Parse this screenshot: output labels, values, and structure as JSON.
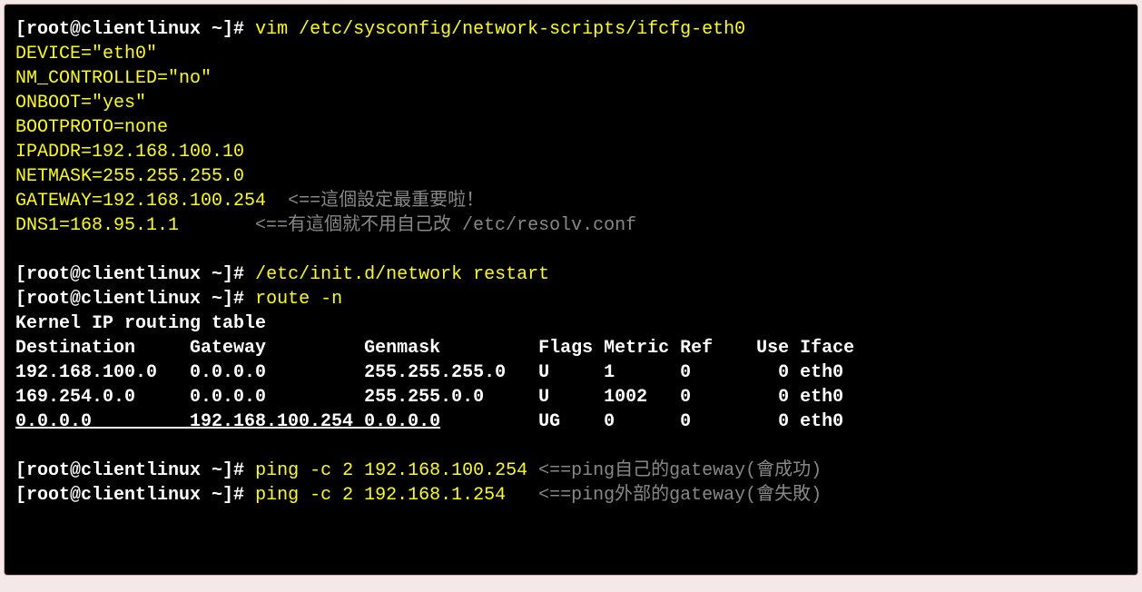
{
  "prompt": "[root@clientlinux ~]#",
  "cmd1": "vim /etc/sysconfig/network-scripts/ifcfg-eth0",
  "cfg": {
    "l1": "DEVICE=\"eth0\"",
    "l2": "NM_CONTROLLED=\"no\"",
    "l3": "ONBOOT=\"yes\"",
    "l4": "BOOTPROTO=none",
    "l5": "IPADDR=192.168.100.10",
    "l6": "NETMASK=255.255.255.0",
    "l7": "GATEWAY=192.168.100.254",
    "l8": "DNS1=168.95.1.1"
  },
  "comment_gateway": "<==這個設定最重要啦！",
  "comment_dns": "<==有這個就不用自己改 /etc/resolv.conf",
  "cmd2": "/etc/init.d/network restart",
  "cmd3": "route -n",
  "route_title": "Kernel IP routing table",
  "route_header": "Destination     Gateway         Genmask         Flags Metric Ref    Use Iface",
  "route_rows": {
    "r1": "192.168.100.0   0.0.0.0         255.255.255.0   U     1      0        0 eth0",
    "r2": "169.254.0.0     0.0.0.0         255.255.0.0     U     1002   0        0 eth0",
    "r3a": "0.0.0.0         192.168.100.254 0.0.0.0",
    "r3b": "         UG    0      0        0 eth0"
  },
  "cmd4": "ping -c 2 192.168.100.254",
  "comment_ping1": "<==ping自己的gateway(會成功)",
  "cmd5": "ping -c 2 192.168.1.254",
  "comment_ping2": "<==ping外部的gateway(會失敗)"
}
